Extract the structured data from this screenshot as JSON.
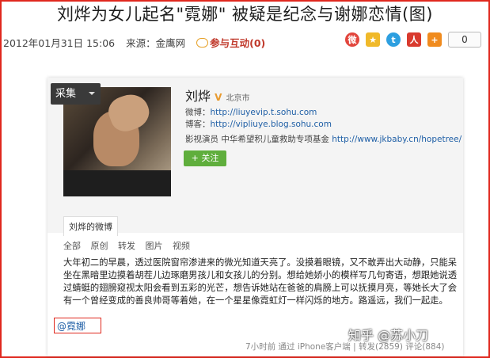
{
  "article": {
    "title": "刘烨为女儿起名\"霓娜\" 被疑是纪念与谢娜恋情(图)",
    "date": "2012年01月31日 15:06",
    "source": "来源：金鹰网",
    "interact_label": "参与互动(0)",
    "share_count": "0"
  },
  "share_icons": [
    "weibo-icon",
    "qzone-icon",
    "tencent-weibo-icon",
    "renren-icon",
    "more-share-icon"
  ],
  "screenshot": {
    "collect_label": "采集",
    "name": "刘烨",
    "verified": "V",
    "location": "北京市",
    "weibo_label": "微博：",
    "weibo_url": "http://liuyevip.t.sohu.com",
    "blog_label": "博客：",
    "blog_url": "http://vipliuye.blog.sohu.com",
    "bio": "影视演员 中华希望积儿童救助专项基金",
    "bio_url": "http://www.jkbaby.cn/hopetree/",
    "follow_label": "+ 关注",
    "tab_label": "刘烨的微博",
    "filters": [
      "全部",
      "原创",
      "转发",
      "图片",
      "视频"
    ],
    "post_text": "大年初二的早晨，透过医院窗帘渗进来的微光知道天亮了。没摸着眼镜，又不敢弄出大动静，只能呆坐在黑暗里边摸着胡茬儿边琢磨男孩儿和女孩儿的分别。想给她娇小的模样写几句寄语，想跟她说透过蜻蜓的翅膀窥视太阳会看到五彩的光芒，想告诉她站在爸爸的肩膀上可以抚摸月亮，等她长大了会有一个曾经变成的善良帅哥等着她，在一个星星像霓虹灯一样闪烁的地方。路遥远，我们一起走。",
    "mention": "@霓娜",
    "footer": "7小时前 通过 iPhone客户端 | 转发(2859) 评论(884)"
  },
  "watermark": "知乎 @苏小刀",
  "colors": {
    "frame_red": "#e0281e",
    "follow_green": "#5fae3c",
    "link_blue": "#1f5fa6"
  }
}
